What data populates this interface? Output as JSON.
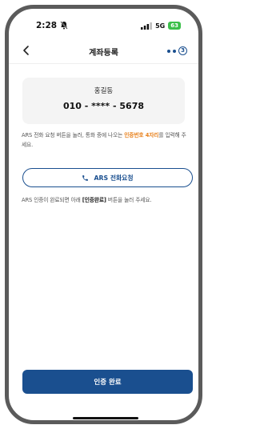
{
  "status_bar": {
    "time": "2:28",
    "network": "5G",
    "battery": "63"
  },
  "header": {
    "title": "계좌등록",
    "step": "3"
  },
  "account": {
    "name": "홍길동",
    "phone": "010 - **** - 5678"
  },
  "guide": {
    "before": "ARS 전화 요청 버튼을 눌러, 통화 중에 나오는 ",
    "highlight": "인증번호 4자리",
    "after": "를 입력해 주세요."
  },
  "ars_button": {
    "label": "ARS 전화요청"
  },
  "note": {
    "before": "ARS 인증이 완료되면 아래 ",
    "bold": "[인증완료]",
    "after": " 버튼을 눌러 주세요."
  },
  "confirm_button": {
    "label": "인증 완료"
  },
  "colors": {
    "primary": "#1a4f8f",
    "highlight": "#e8821e",
    "battery": "#3bbf4a"
  },
  "icons": [
    "bell-off-icon",
    "signal-icon",
    "back-arrow-icon",
    "phone-icon"
  ]
}
